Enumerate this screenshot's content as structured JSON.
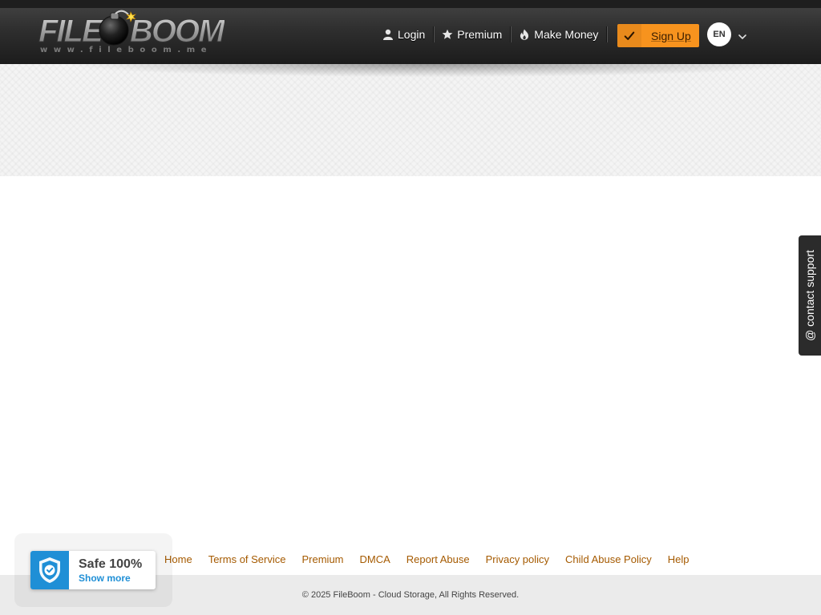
{
  "header": {
    "logo_text_left": "FILE",
    "logo_text_right": "BOOM",
    "logo_url": "www.fileboom.me",
    "nav": [
      {
        "label": "Login",
        "icon": "user-icon"
      },
      {
        "label": "Premium",
        "icon": "star-icon"
      },
      {
        "label": "Make Money",
        "icon": "flame-icon"
      }
    ],
    "signup_label": "Sign Up",
    "signup_icon": "checkmark-icon",
    "language": "EN"
  },
  "contact_support": "@ contact support",
  "footer": {
    "links": [
      "Home",
      "Terms of Service",
      "Premium",
      "DMCA",
      "Report Abuse",
      "Privacy policy",
      "Child Abuse Policy",
      "Help"
    ],
    "copyright": "© 2025 FileBoom - Cloud Storage, All Rights Reserved."
  },
  "safe_badge": {
    "title": "Safe 100%",
    "link": "Show more"
  },
  "colors": {
    "signup_accent": "#f7931e",
    "footer_link": "#a55a00",
    "badge_blue": "#1f8fd6"
  }
}
